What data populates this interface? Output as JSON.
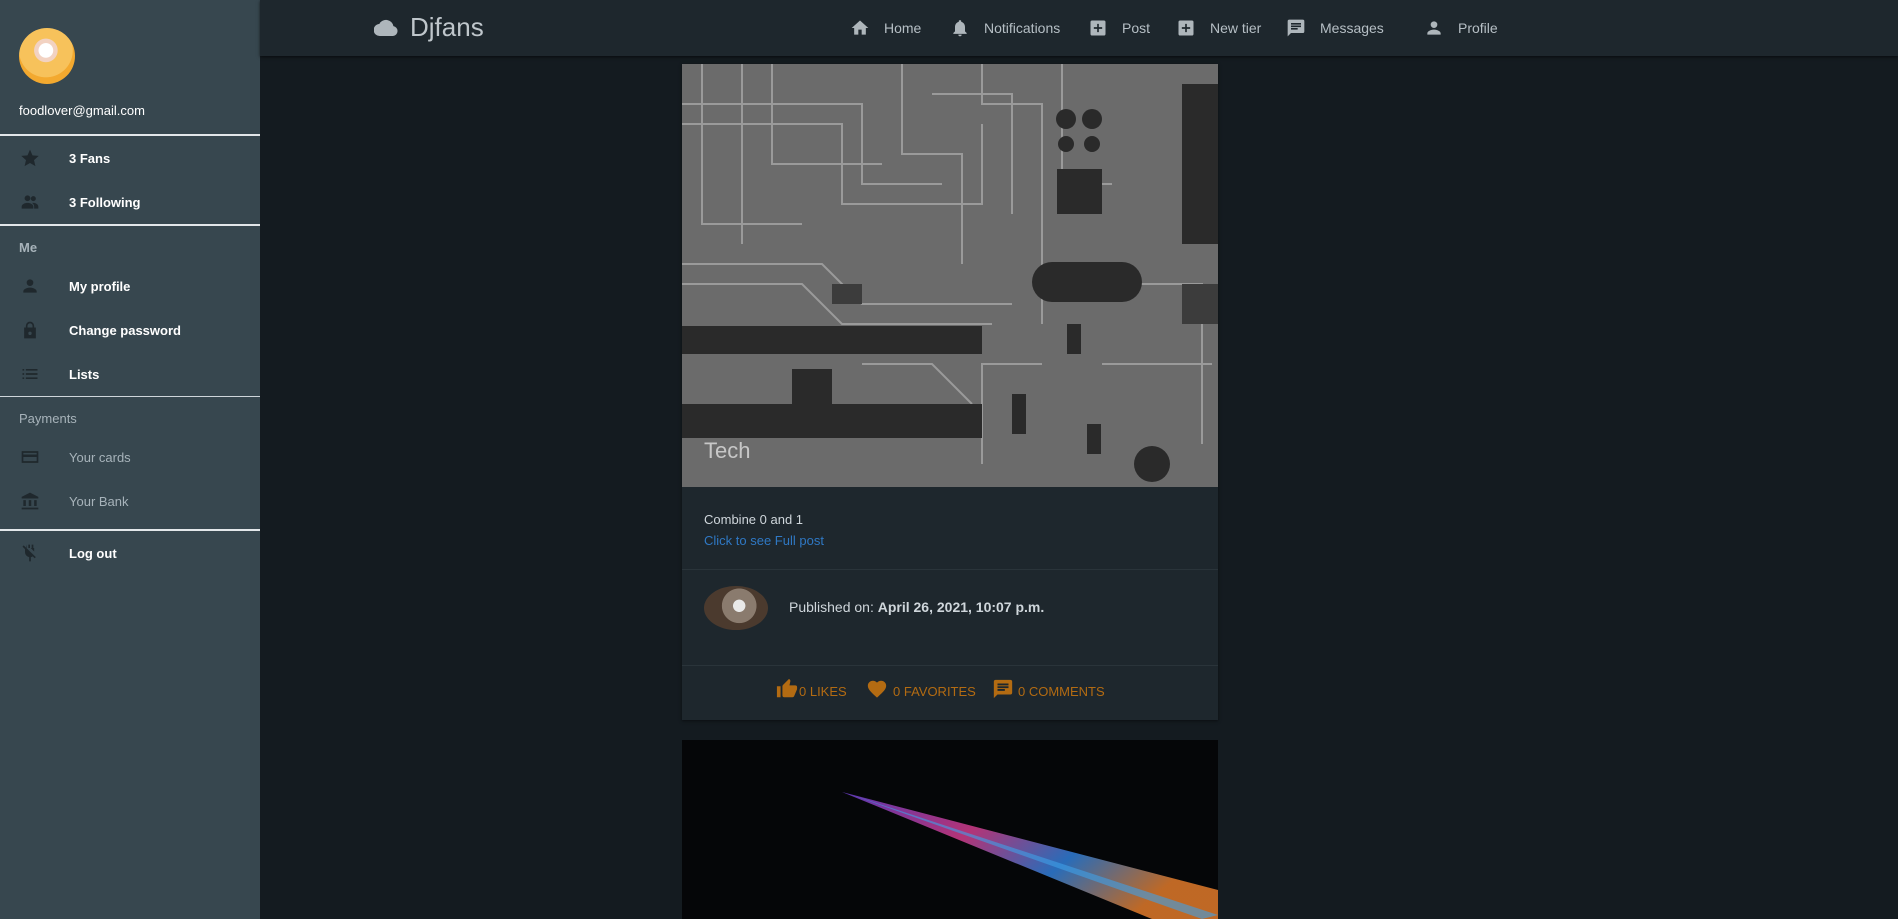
{
  "sidebar": {
    "email": "foodlover@gmail.com",
    "stats": [
      {
        "label": "3 Fans",
        "icon": "star-icon"
      },
      {
        "label": "3 Following",
        "icon": "people-icon"
      }
    ],
    "me_heading": "Me",
    "me_items": [
      {
        "label": "My profile",
        "icon": "person-icon"
      },
      {
        "label": "Change password",
        "icon": "lock-icon"
      },
      {
        "label": "Lists",
        "icon": "list-icon"
      }
    ],
    "payments_heading": "Payments",
    "payment_items": [
      {
        "label": "Your cards",
        "icon": "card-icon"
      },
      {
        "label": "Your Bank",
        "icon": "bank-icon"
      }
    ],
    "logout": "Log out"
  },
  "header": {
    "brand": "Djfans",
    "nav": [
      {
        "label": "Home",
        "icon": "home-icon"
      },
      {
        "label": "Notifications",
        "icon": "bell-icon"
      },
      {
        "label": "Post",
        "icon": "plus-box-icon"
      },
      {
        "label": "New tier",
        "icon": "plus-box-icon"
      },
      {
        "label": "Messages",
        "icon": "chat-icon"
      },
      {
        "label": "Profile",
        "icon": "person-icon"
      }
    ]
  },
  "post": {
    "category": "Tech",
    "excerpt": "Combine 0 and 1",
    "full_link": "Click to see Full post",
    "published_prefix": "Published on:",
    "published_date": "April 26, 2021, 10:07 p.m.",
    "likes": "0 LIKES",
    "favorites": "0 FAVORITES",
    "comments": "0 COMMENTS"
  },
  "colors": {
    "sidebar_bg": "#37474f",
    "page_bg": "#141b20",
    "accent_orange": "#b36b12",
    "link_blue": "#2f78c4"
  }
}
